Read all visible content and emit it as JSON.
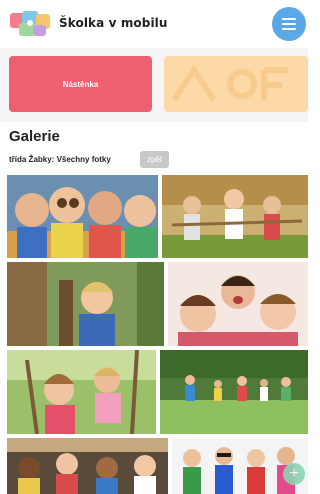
{
  "header": {
    "brand": "Školka v mobilu"
  },
  "tiles": {
    "wall_label": "Nástěnka",
    "second_label": ""
  },
  "gallery": {
    "title": "Galerie",
    "filter_label": "třída Žabky: Všechny fotky",
    "back_label": "zpět",
    "photos": [
      "children-binoculars-photo",
      "children-tug-of-war-photo",
      "boy-behind-tree-photo",
      "children-funny-faces-photo",
      "girls-on-swing-photo",
      "children-running-in-park-photo",
      "children-in-classroom-photo",
      "children-superhero-costumes-photo"
    ]
  },
  "colors": {
    "menu": "#5aa9e6",
    "wall_tile": "#ee5f70",
    "second_tile": "#fdd9a8",
    "back": "#c8c8c8"
  },
  "icons": {
    "menu": "hamburger-menu-icon",
    "fab": "plus-icon"
  }
}
